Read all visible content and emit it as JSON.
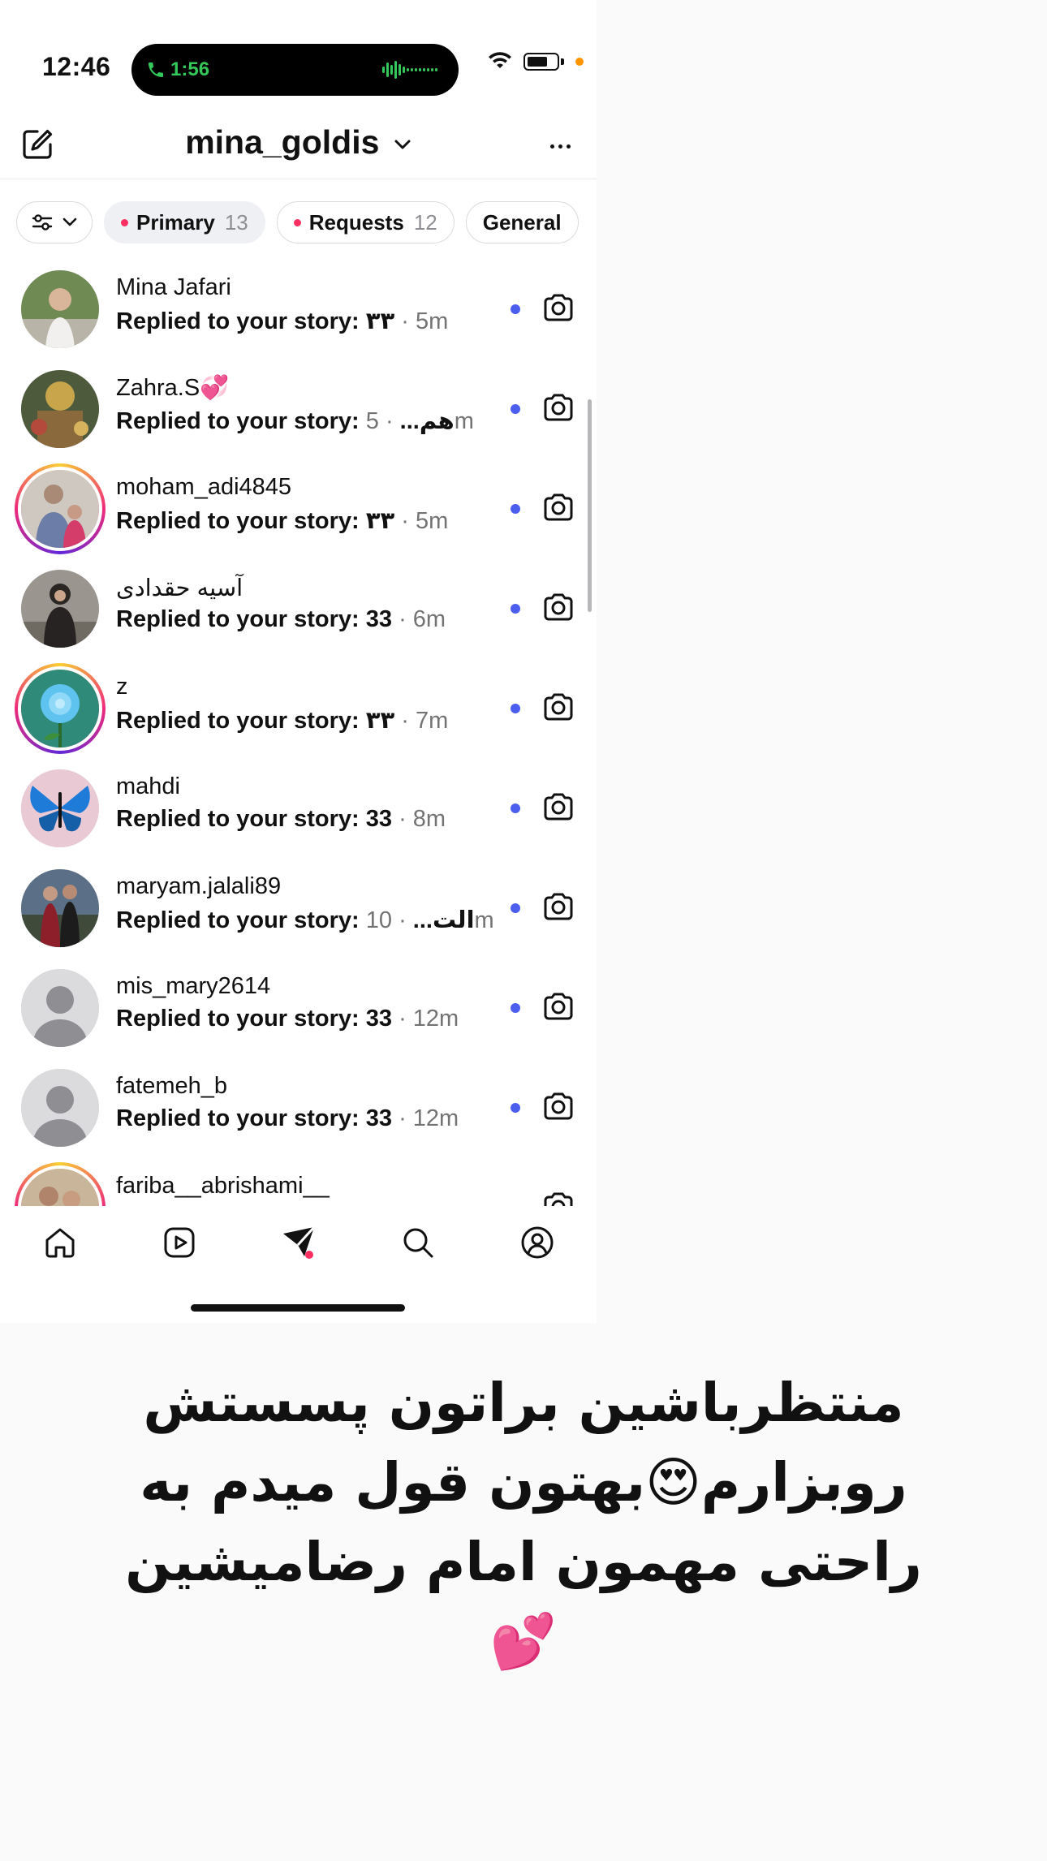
{
  "status_bar": {
    "time": "12:46",
    "call_timer": "1:56",
    "accent_call_color": "#34c759",
    "privacy_dot_color": "#ff9500"
  },
  "header": {
    "account_name": "mina_goldis",
    "left_icon": "compose-icon",
    "right_icon": "more-icon"
  },
  "tabs": [
    {
      "label": "Primary",
      "count": "13",
      "active": true
    },
    {
      "label": "Requests",
      "count": "12",
      "active": false
    },
    {
      "label": "General",
      "count": "",
      "active": false
    }
  ],
  "threads": [
    {
      "name": "Mina Jafari",
      "preview": "Replied to your story: ۳۳",
      "time": "· 5m",
      "ring": false
    },
    {
      "name": "Zahra.S💞",
      "preview": "Replied to your story: هم... ",
      "time": "· 5m",
      "ring": false
    },
    {
      "name": "moham_adi4845",
      "preview": "Replied to your story: ۳۳",
      "time": "· 5m",
      "ring": true
    },
    {
      "name": "آسیه حقدادی",
      "preview": "Replied to your story: 33",
      "time": "· 6m",
      "ring": false
    },
    {
      "name": "z",
      "preview": "Replied to your story: ۳۳",
      "time": "· 7m",
      "ring": true
    },
    {
      "name": "mahdi",
      "preview": "Replied to your story: 33",
      "time": "· 8m",
      "ring": false
    },
    {
      "name": "maryam.jalali89",
      "preview": "Replied to your story: الت... ",
      "time": "· 10m",
      "ring": false
    },
    {
      "name": "mis_mary2614",
      "preview": "Replied to your story: 33",
      "time": "· 12m",
      "ring": false
    },
    {
      "name": "fatemeh_b",
      "preview": "Replied to your story: 33",
      "time": "· 12m",
      "ring": false
    },
    {
      "name": "fariba__abrishami__",
      "preview": "",
      "time": "",
      "ring": true
    }
  ],
  "colors": {
    "unread_dot": "#4c5ef0",
    "notification_dot": "#ff2f62"
  },
  "bottom_nav": [
    "home-icon",
    "reels-icon",
    "direct-icon",
    "search-icon",
    "profile-icon"
  ],
  "caption": {
    "line1": "منتظرباشین براتون پسستش",
    "line2": "روبزارم😍بهتون قول میدم به",
    "line3": "راحتی مهمون امام رضامیشین💕"
  }
}
